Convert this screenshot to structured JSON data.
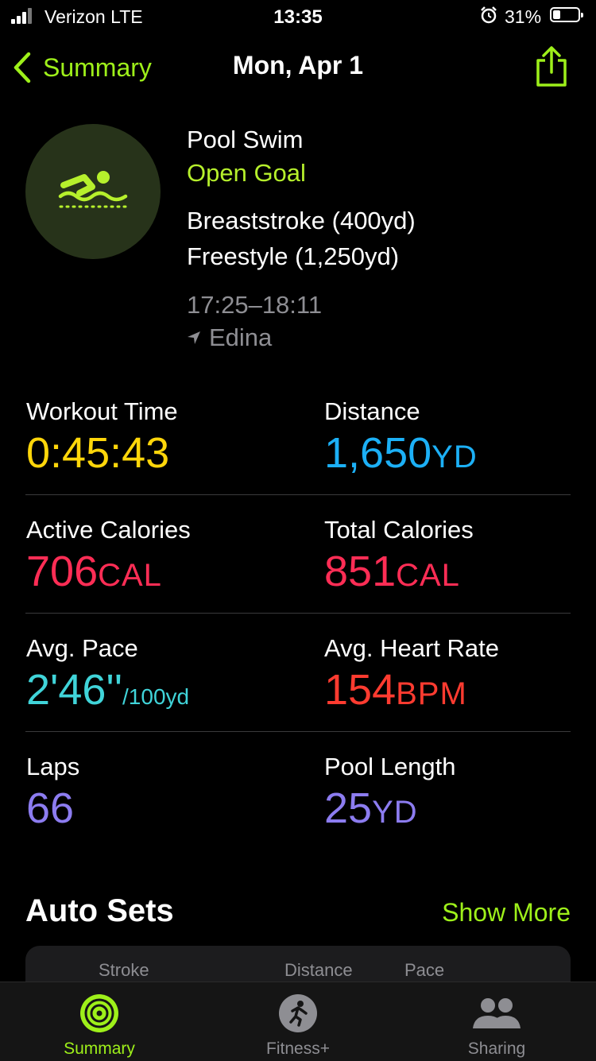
{
  "status_bar": {
    "carrier": "Verizon  LTE",
    "time": "13:35",
    "battery_percent": "31%",
    "battery_level": 0.31
  },
  "nav": {
    "back_label": "Summary",
    "title": "Mon, Apr 1"
  },
  "workout": {
    "name": "Pool Swim",
    "goal": "Open Goal",
    "laps": [
      "Breaststroke (400yd)",
      "Freestyle (1,250yd)"
    ],
    "time_range": "17:25–18:11",
    "location": "Edina",
    "icon": "swimmer-icon"
  },
  "metrics": [
    {
      "label": "Workout Time",
      "value": "0:45:43",
      "unit": "",
      "color": "#ffd60a"
    },
    {
      "label": "Distance",
      "value": "1,650",
      "unit": "YD",
      "color": "#1cb0f6"
    },
    {
      "label": "Active Calories",
      "value": "706",
      "unit": "CAL",
      "color": "#ff2d55"
    },
    {
      "label": "Total Calories",
      "value": "851",
      "unit": "CAL",
      "color": "#ff2d55"
    },
    {
      "label": "Avg. Pace",
      "value": "2'46''",
      "unit": "/100yd",
      "color": "#40d4d9"
    },
    {
      "label": "Avg. Heart Rate",
      "value": "154",
      "unit": "BPM",
      "color": "#ff3b30"
    },
    {
      "label": "Laps",
      "value": "66",
      "unit": "",
      "color": "#8c7cf0"
    },
    {
      "label": "Pool Length",
      "value": "25",
      "unit": "YD",
      "color": "#8c7cf0"
    }
  ],
  "auto_sets": {
    "title": "Auto Sets",
    "show_more": "Show More",
    "columns": [
      "Stroke",
      "Distance",
      "Pace"
    ]
  },
  "tabbar": {
    "items": [
      {
        "label": "Summary",
        "icon": "activity-rings-icon",
        "active": true
      },
      {
        "label": "Fitness+",
        "icon": "running-figure-icon",
        "active": false
      },
      {
        "label": "Sharing",
        "icon": "people-icon",
        "active": false
      }
    ]
  },
  "colors": {
    "accent": "#9ef01a",
    "secondary_text": "#8e8e93"
  }
}
